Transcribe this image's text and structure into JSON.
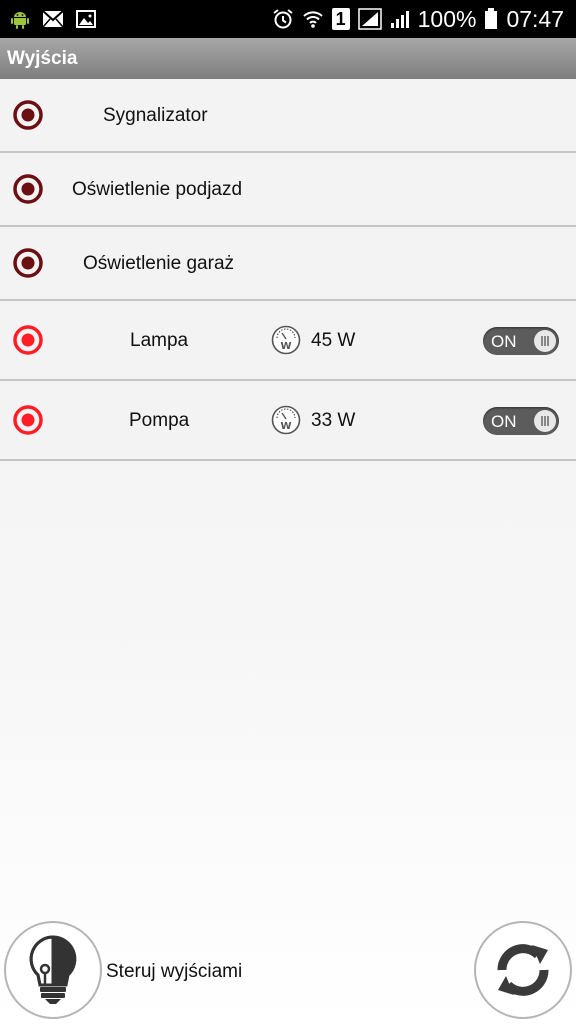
{
  "status_bar": {
    "icons": [
      "android-icon",
      "mail-icon",
      "image-icon",
      "alarm-icon",
      "wifi-icon",
      "sim-1-icon",
      "signal-icon",
      "signal-icon",
      "battery-icon"
    ],
    "sim_slot": "1",
    "battery": "100%",
    "time": "07:47"
  },
  "title_bar": {
    "title": "Wyjścia"
  },
  "outputs": [
    {
      "name": "Sygnalizator",
      "state_color": "#6b0f12"
    },
    {
      "name": "Oświetlenie podjazd",
      "state_color": "#6b0f12"
    },
    {
      "name": "Oświetlenie garaż",
      "state_color": "#6b0f12"
    },
    {
      "name": "Lampa",
      "state_color": "#ff1e26",
      "power": "45 W",
      "toggle": "ON"
    },
    {
      "name": "Pompa",
      "state_color": "#ff1e26",
      "power": "33 W",
      "toggle": "ON"
    }
  ],
  "bottom": {
    "control_label": "Steruj wyjściami",
    "control_icon": "lightbulb-icon",
    "refresh_icon": "refresh-icon"
  },
  "colors": {
    "active": "#ff1e26",
    "inactive": "#6b0f12",
    "title_bar": "#8f8f8f",
    "toggle": "#5c5c5c"
  }
}
